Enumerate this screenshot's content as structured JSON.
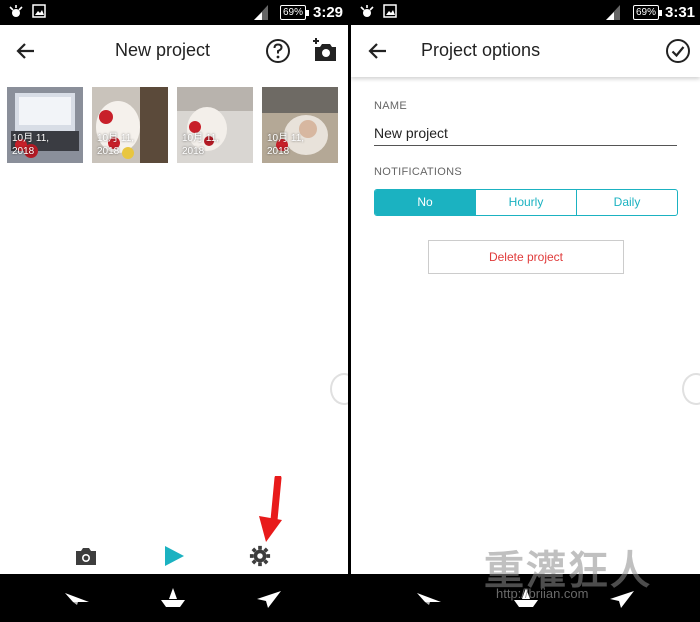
{
  "status_left": {
    "battery": "69%",
    "time": "3:29"
  },
  "status_right": {
    "battery": "69%",
    "time": "3:31"
  },
  "left": {
    "title": "New project",
    "thumbnails": [
      {
        "caption_line1": "10月 11,",
        "caption_line2": "2018"
      },
      {
        "caption_line1": "10月 11,",
        "caption_line2": "2018"
      },
      {
        "caption_line1": "10月 11,",
        "caption_line2": "2018"
      },
      {
        "caption_line1": "10月 11,",
        "caption_line2": "2018"
      }
    ],
    "tools": [
      "camera-icon",
      "play-icon",
      "settings-gear-icon"
    ]
  },
  "right": {
    "title": "Project options",
    "name_label": "NAME",
    "name_value": "New project",
    "notifications_label": "NOTIFICATIONS",
    "notification_options": [
      "No",
      "Hourly",
      "Daily"
    ],
    "notification_selected": "No",
    "delete_label": "Delete project"
  },
  "nav_icons": [
    "paper-plane-left-icon",
    "paper-boat-icon",
    "paper-plane-right-icon"
  ],
  "watermark": {
    "text": "重灌狂人",
    "url": "http://briian.com"
  },
  "colors": {
    "accent": "#1bb2c1",
    "danger": "#e03a3a",
    "annotation_arrow": "#e81a1a"
  }
}
